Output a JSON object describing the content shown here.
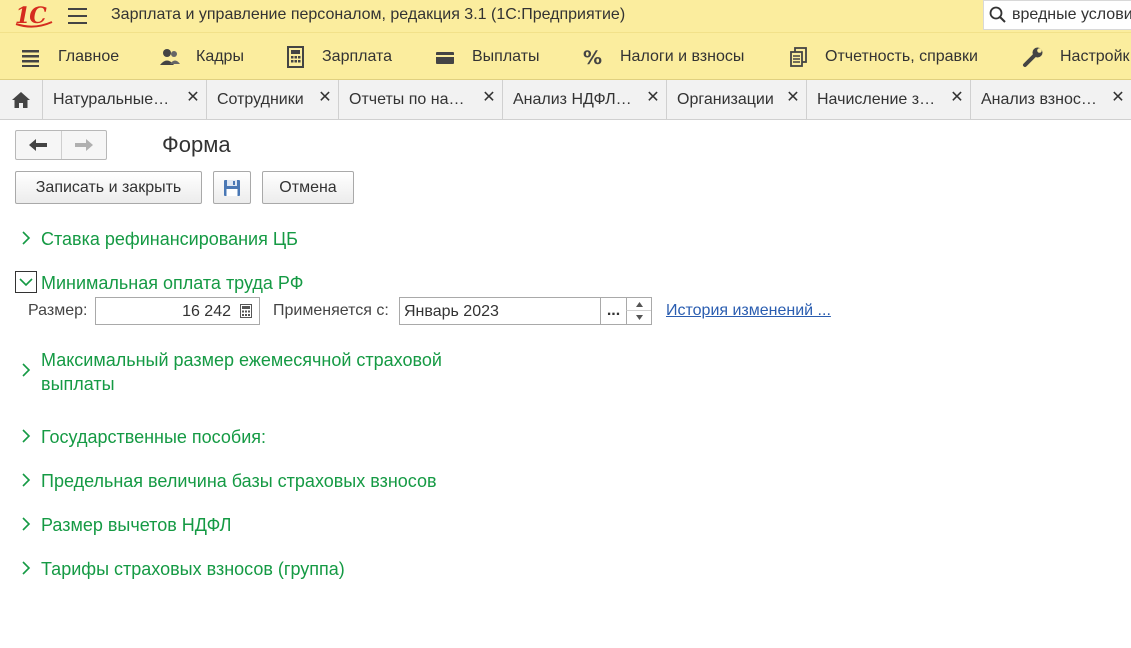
{
  "titlebar": {
    "logo": "1С",
    "title": "Зарплата и управление персоналом, редакция 3.1  (1С:Предприятие)",
    "search_value": "вредные услови"
  },
  "sections": [
    {
      "label": "Главное",
      "icon": "menu-lines-icon"
    },
    {
      "label": "Кадры",
      "icon": "people-icon"
    },
    {
      "label": "Зарплата",
      "icon": "calculator-icon"
    },
    {
      "label": "Выплаты",
      "icon": "wallet-icon"
    },
    {
      "label": "Налоги и взносы",
      "icon": "percent-icon"
    },
    {
      "label": "Отчетность, справки",
      "icon": "documents-icon"
    },
    {
      "label": "Настройк",
      "icon": "wrench-icon"
    }
  ],
  "tabs": [
    {
      "label": "Натуральные…"
    },
    {
      "label": "Сотрудники"
    },
    {
      "label": "Отчеты по на…"
    },
    {
      "label": "Анализ НДФЛ…"
    },
    {
      "label": "Организации"
    },
    {
      "label": "Начисление з…"
    },
    {
      "label": "Анализ взнос…"
    }
  ],
  "form": {
    "title": "Форма",
    "save_close_label": "Записать и закрыть",
    "cancel_label": "Отмена"
  },
  "groups": {
    "refinancing": "Ставка рефинансирования ЦБ",
    "min_wage": "Минимальная оплата труда РФ",
    "max_payment_line1": "Максимальный размер ежемесячной страховой",
    "max_payment_line2": "выплаты",
    "benefits": "Государственные пособия:",
    "base_limit": "Предельная величина базы страховых взносов",
    "ndfl_deductions": "Размер вычетов НДФЛ",
    "tariffs": "Тарифы страховых взносов (группа)"
  },
  "min_wage_fields": {
    "size_label": "Размер:",
    "size_value": "16 242",
    "applies_label": "Применяется с:",
    "applies_value": "Январь 2023",
    "select_button": "...",
    "history_link": "История изменений ..."
  }
}
